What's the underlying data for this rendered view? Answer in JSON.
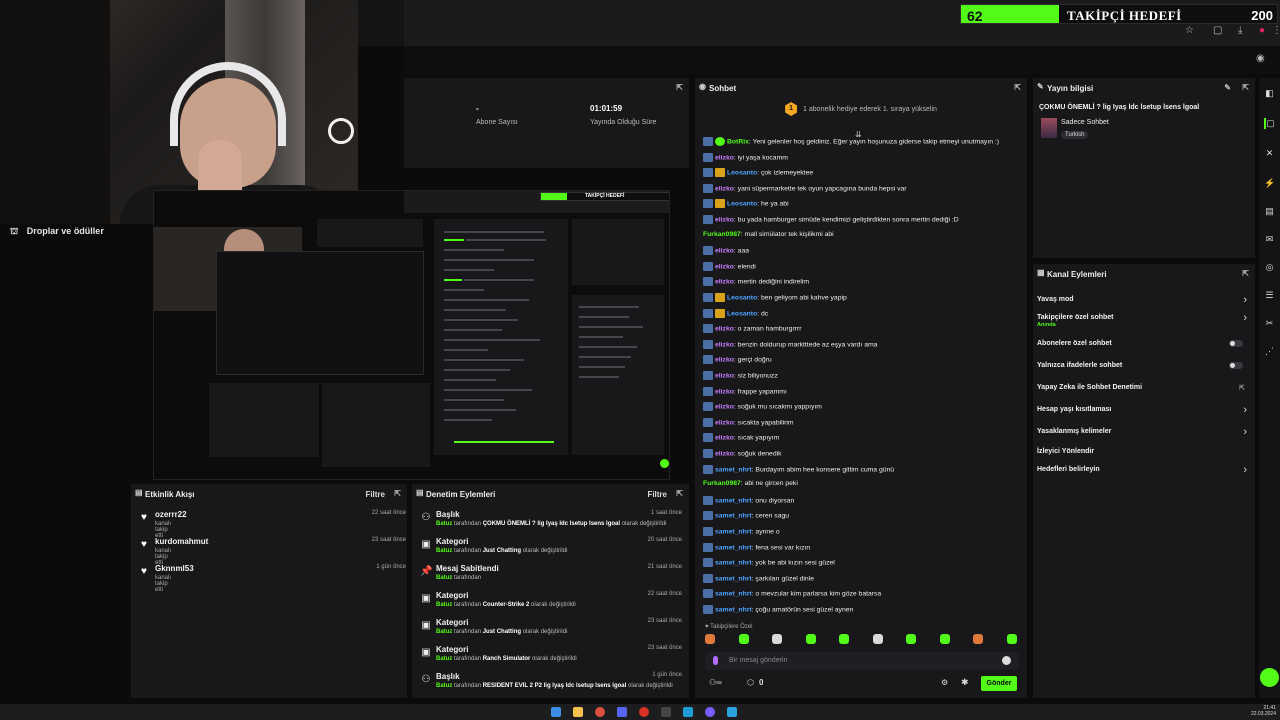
{
  "goal": {
    "current": "62",
    "title": "TAKİPÇİ HEDEFİ",
    "target": "200",
    "progress_fraction": 0.31,
    "accent": "#53fc18"
  },
  "overlay": {
    "drops_label": "Droplar ve ödüller"
  },
  "stats": {
    "subscribers_value": "-",
    "subscribers_label": "Abone Sayısı",
    "uptime_value": "01:01:59",
    "uptime_label": "Yayında Olduğu Süre"
  },
  "activity": {
    "title": "Etkinlik Akışı",
    "filter": "Filtre",
    "items": [
      {
        "name": "ozerrr22",
        "sub": "kanalı takip etti",
        "time": "22 saat önce"
      },
      {
        "name": "kurdomahmut",
        "sub": "kanalı takip etti",
        "time": "23 saat önce"
      },
      {
        "name": "Gknnml53",
        "sub": "kanalı takip etti",
        "time": "1 gün önce"
      }
    ]
  },
  "moderation": {
    "title": "Denetim Eylemleri",
    "filter": "Filtre",
    "items": [
      {
        "title": "Başlık",
        "user": "Batuz",
        "pre": " tarafından ",
        "value": "ÇOKMU ÖNEMLİ ? lig Iyaş ldc lsetup lsens lgoal",
        "post": " olarak değiştirildi",
        "time": "1 saat önce",
        "icon": "title-icon"
      },
      {
        "title": "Kategori",
        "user": "Batuz",
        "pre": " tarafından ",
        "value": "Just Chatting",
        "post": " olarak değiştirildi",
        "time": "20 saat önce",
        "icon": "category-icon"
      },
      {
        "title": "Mesaj Sabitlendi",
        "user": "Batuz",
        "pre": " tarafından",
        "value": "",
        "post": "",
        "time": "21 saat önce",
        "icon": "pin-icon"
      },
      {
        "title": "Kategori",
        "user": "Batuz",
        "pre": " tarafından ",
        "value": "Counter-Strike 2",
        "post": " olarak değiştirildi",
        "time": "22 saat önce",
        "icon": "category-icon"
      },
      {
        "title": "Kategori",
        "user": "Batuz",
        "pre": " tarafından ",
        "value": "Just Chatting",
        "post": " olarak değiştirildi",
        "time": "23 saat önce",
        "icon": "category-icon"
      },
      {
        "title": "Kategori",
        "user": "Batuz",
        "pre": " tarafından ",
        "value": "Ranch Simulator",
        "post": " olarak değiştirildi",
        "time": "23 saat önce",
        "icon": "category-icon"
      },
      {
        "title": "Başlık",
        "user": "Batuz",
        "pre": " tarafından ",
        "value": "RESIDENT EVIL 2 P2 lig Iyaş ldc lsetup lsens lgoal",
        "post": " olarak değiştirildi",
        "time": "1 gün önce",
        "icon": "title-icon"
      }
    ]
  },
  "chat": {
    "title": "Sohbet",
    "banner": "1 abonelik hediye ederek 1. sıraya yükselin",
    "banner_rank": "1",
    "messages": [
      {
        "user": "BotRix",
        "color": "#53fc18",
        "badge": "bot",
        "text": "Yeni gelenler hoş geldiniz. Eğer yayın hoşunuza giderse takip etmeyi unutmayın :)"
      },
      {
        "user": "elizko",
        "color": "#c77dff",
        "badge": "sub",
        "text": "iyi yaşa kocamm"
      },
      {
        "user": "Leosanto",
        "color": "#4fa3ff",
        "badge": "vip",
        "text": "çok izlemeyektee"
      },
      {
        "user": "elizko",
        "color": "#c77dff",
        "badge": "sub",
        "text": "yani süpermarkette tek oyun yapcagına bunda hepsi var"
      },
      {
        "user": "Leosanto",
        "color": "#4fa3ff",
        "badge": "vip",
        "text": "he ya abi"
      },
      {
        "user": "elizko",
        "color": "#c77dff",
        "badge": "sub",
        "text": "bu yada hamburger simüde kendimizi geliştirdikten sonra mertin dediği :D"
      },
      {
        "user": "Furkan0987",
        "color": "#53fc18",
        "badge": "",
        "text": "mall simülator tek kişilikmi abi"
      },
      {
        "user": "elizko",
        "color": "#c77dff",
        "badge": "sub",
        "text": "aaa"
      },
      {
        "user": "elizko",
        "color": "#c77dff",
        "badge": "sub",
        "text": "elendi"
      },
      {
        "user": "elizko",
        "color": "#c77dff",
        "badge": "sub",
        "text": "mertin dediğini indirelim"
      },
      {
        "user": "Leosanto",
        "color": "#4fa3ff",
        "badge": "vip",
        "text": "ben geliyom abi kahve yapip"
      },
      {
        "user": "Leosanto",
        "color": "#4fa3ff",
        "badge": "vip",
        "text": "dc"
      },
      {
        "user": "elizko",
        "color": "#c77dff",
        "badge": "sub",
        "text": "o zaman hamburgrrrr"
      },
      {
        "user": "elizko",
        "color": "#c77dff",
        "badge": "sub",
        "text": "benzin doldurup marktttede az eşya vardı ama"
      },
      {
        "user": "elizko",
        "color": "#c77dff",
        "badge": "sub",
        "text": "gerçi doğru"
      },
      {
        "user": "elizko",
        "color": "#c77dff",
        "badge": "sub",
        "text": "siz biliyonuzz"
      },
      {
        "user": "elizko",
        "color": "#c77dff",
        "badge": "sub",
        "text": "frappe yapammı"
      },
      {
        "user": "elizko",
        "color": "#c77dff",
        "badge": "sub",
        "text": "soğuk mu sıcakmı yappıyım"
      },
      {
        "user": "elizko",
        "color": "#c77dff",
        "badge": "sub",
        "text": "sıcakta yapabilirim"
      },
      {
        "user": "elizko",
        "color": "#c77dff",
        "badge": "sub",
        "text": "sıcak yapıyım"
      },
      {
        "user": "elizko",
        "color": "#c77dff",
        "badge": "sub",
        "text": "soğuk denedik"
      },
      {
        "user": "samet_nhrt",
        "color": "#4fa3ff",
        "badge": "sub",
        "text": "Burdayım abim hee konsere gittim cuma günü"
      },
      {
        "user": "Furkan0987",
        "color": "#53fc18",
        "badge": "",
        "text": "abi ne gircen peki"
      },
      {
        "user": "samet_nhrt",
        "color": "#4fa3ff",
        "badge": "sub",
        "text": "onu diyorsan"
      },
      {
        "user": "samet_nhrt",
        "color": "#4fa3ff",
        "badge": "sub",
        "text": "ceren sagu"
      },
      {
        "user": "samet_nhrt",
        "color": "#4fa3ff",
        "badge": "sub",
        "text": "aynne o"
      },
      {
        "user": "samet_nhrt",
        "color": "#4fa3ff",
        "badge": "sub",
        "text": "fena sesi var kızın"
      },
      {
        "user": "samet_nhrt",
        "color": "#4fa3ff",
        "badge": "sub",
        "text": "yok be abi kızın sesi güzel"
      },
      {
        "user": "samet_nhrt",
        "color": "#4fa3ff",
        "badge": "sub",
        "text": "şarkıları güzel dinle"
      },
      {
        "user": "samet_nhrt",
        "color": "#4fa3ff",
        "badge": "sub",
        "text": "o mevzular kim parlarsa kim göze batarsa"
      },
      {
        "user": "samet_nhrt",
        "color": "#4fa3ff",
        "badge": "sub",
        "text": "çoğu amatörün sesi güzel aynen"
      }
    ],
    "followers_only_label": "Takipçilere Özel",
    "input_placeholder": "Bir mesaj gönderin",
    "count": "0",
    "send_label": "Gönder"
  },
  "stream_info": {
    "title": "Yayın bilgisi",
    "stream_title": "ÇOKMU ÖNEMLİ ? lig Iyaş ldc lsetup lsens lgoal",
    "category": "Sadece Sohbet",
    "tag": "Turkish"
  },
  "channel_actions": {
    "title": "Kanal Eylemleri",
    "items": [
      {
        "label": "Yavaş mod",
        "sub": "",
        "control": "chevron"
      },
      {
        "label": "Takipçilere özel sohbet",
        "sub": "Anında",
        "control": "chevron"
      },
      {
        "label": "Abonelere özel sohbet",
        "sub": "",
        "control": "toggle"
      },
      {
        "label": "Yalnızca ifadelerle sohbet",
        "sub": "",
        "control": "toggle"
      },
      {
        "label": "Yapay Zeka ile Sohbet Denetimi",
        "sub": "",
        "control": "external"
      },
      {
        "label": "Hesap yaşı kısıtlaması",
        "sub": "",
        "control": "chevron"
      },
      {
        "label": "Yasaklanmış kelimeler",
        "sub": "",
        "control": "chevron"
      },
      {
        "label": "İzleyici Yönlendir",
        "sub": "",
        "control": "none"
      },
      {
        "label": "Hedefleri belirleyin",
        "sub": "",
        "control": "chevron"
      }
    ]
  },
  "taskbar": {
    "time": "21:41",
    "date": "22.03.2024"
  }
}
